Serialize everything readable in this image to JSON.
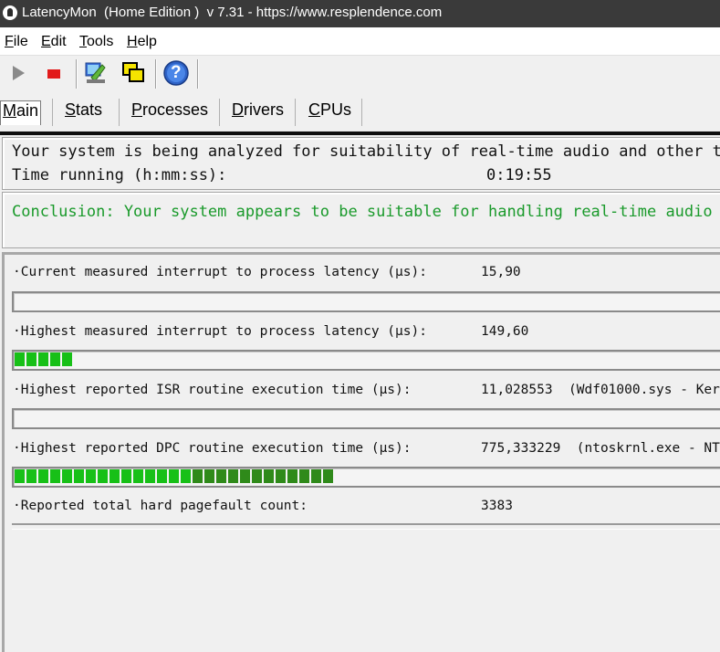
{
  "window": {
    "title": "LatencyMon  (Home Edition )  v 7.31 - https://www.resplendence.com"
  },
  "menu": [
    {
      "underline": "F",
      "rest": "ile"
    },
    {
      "underline": "E",
      "rest": "dit"
    },
    {
      "underline": "T",
      "rest": "ools"
    },
    {
      "underline": "H",
      "rest": "elp"
    }
  ],
  "toolbar": {
    "icons": [
      "play-icon",
      "stop-icon",
      "analyze-icon",
      "windows-icon",
      "help-icon"
    ],
    "help_glyph": "?"
  },
  "tabs": [
    {
      "underline": "M",
      "rest": "ain"
    },
    {
      "underline": "S",
      "rest": "tats"
    },
    {
      "underline": "P",
      "rest": "rocesses"
    },
    {
      "underline": "D",
      "rest": "rivers"
    },
    {
      "underline": "C",
      "rest": "PUs"
    }
  ],
  "status": {
    "line1": "Your system is being analyzed for suitability of real-time audio and other tas",
    "time_label": "Time running (h:mm:ss):",
    "time_value": "0:19:55"
  },
  "conclusion": {
    "text": "Conclusion: Your system appears to be suitable for handling real-time audio an",
    "color": "#1a9a2b"
  },
  "metrics": [
    {
      "label": "·Current measured interrupt to process latency (µs):",
      "value": "15,90",
      "bar_fraction": 0.0
    },
    {
      "label": "·Highest measured interrupt to process latency (µs):",
      "value": "149,60",
      "bar_fraction": 0.075
    },
    {
      "label": "·Highest reported ISR routine execution time (µs):",
      "value": "11,028553  (Wdf01000.sys - Ker",
      "bar_fraction": 0.0
    },
    {
      "label": "·Highest reported DPC routine execution time (µs):",
      "value": "775,333229  (ntoskrnl.exe - NT",
      "bar_fraction": 0.44
    },
    {
      "label": "·Reported total hard pagefault count:",
      "value": "3383",
      "bar_fraction": null
    }
  ],
  "colors": {
    "bar_bright": "#17c017",
    "bar_dark": "#2f8a1a",
    "conclusion_green": "#1a9a2b"
  }
}
